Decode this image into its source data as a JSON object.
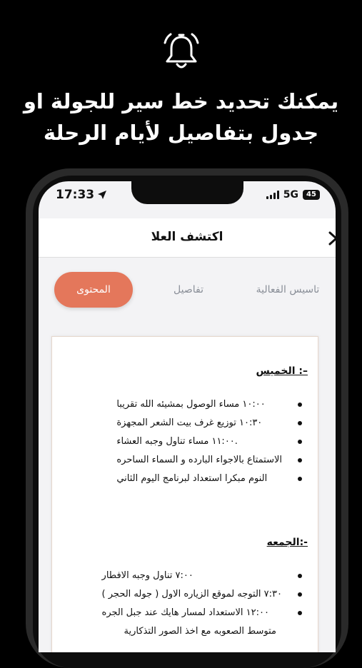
{
  "promo": {
    "line1": "يمكنك تحديد خط سير للجولة او",
    "line2": "جدول بتفاصيل لأيام الرحلة",
    "icon": "bell-icon"
  },
  "status_bar": {
    "time": "17:33",
    "network": "5G",
    "battery": "45"
  },
  "nav": {
    "title": "اكتشف العلا",
    "back_icon": "chevron-right-icon"
  },
  "tabs": [
    {
      "label": "تاسيس الفعالية"
    },
    {
      "label": "تفاصيل"
    },
    {
      "label": "المحتوى",
      "active": true
    }
  ],
  "accent_color": "#e4775b",
  "document": {
    "day1_heading": "الخميس :–",
    "day1_items": [
      "١٠:٠٠ مساء الوصول بمشيئه الله تقريبا",
      "١٠:٣٠ توزيع غرف بيت الشعر المجهزة",
      "١١:٠٠ مساء تناول وجبه العشاء.",
      "الاستمتاع بالاجواء البارده و السماء الساحره",
      "النوم مبكرا استعداد لبرنامج اليوم الثاني"
    ],
    "day2_heading": "الجمعه:-",
    "day2_items": [
      "٧:٠٠ تناول وجبه الافطار",
      "٧:٣٠ التوجه لموقع الزياره الاول ( جوله الحجر )",
      "١٢:٠٠ الاستعداد لمسار هايك عند جبل الجره"
    ],
    "day2_continuation": "متوسط الصعوبه مع اخذ الصور التذكارية"
  }
}
